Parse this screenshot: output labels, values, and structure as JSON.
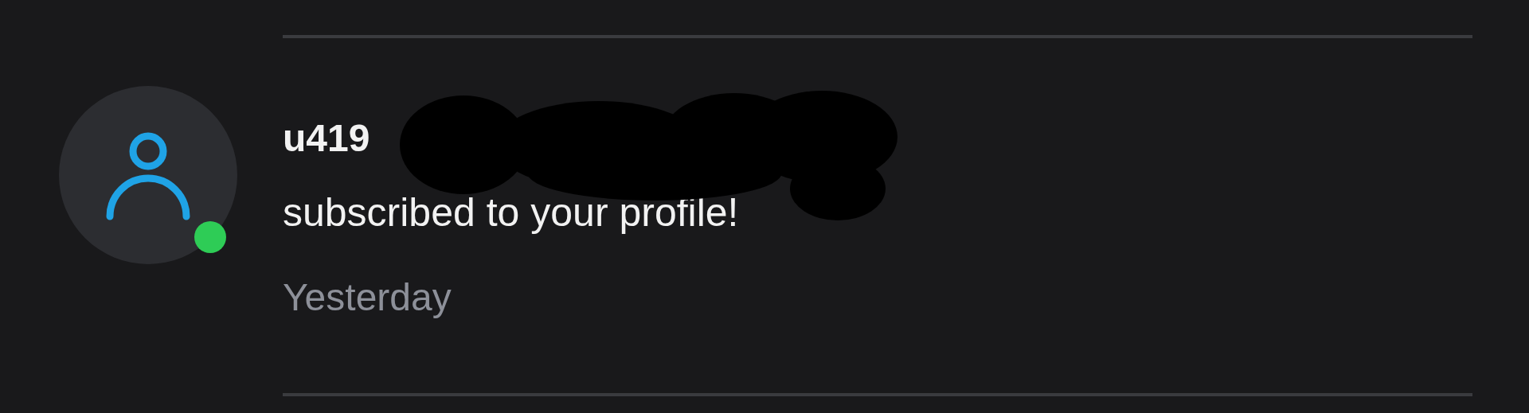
{
  "notification": {
    "username": "u419",
    "redacted": true,
    "message": "subscribed to your profile!",
    "time": "Yesterday",
    "online": true
  }
}
